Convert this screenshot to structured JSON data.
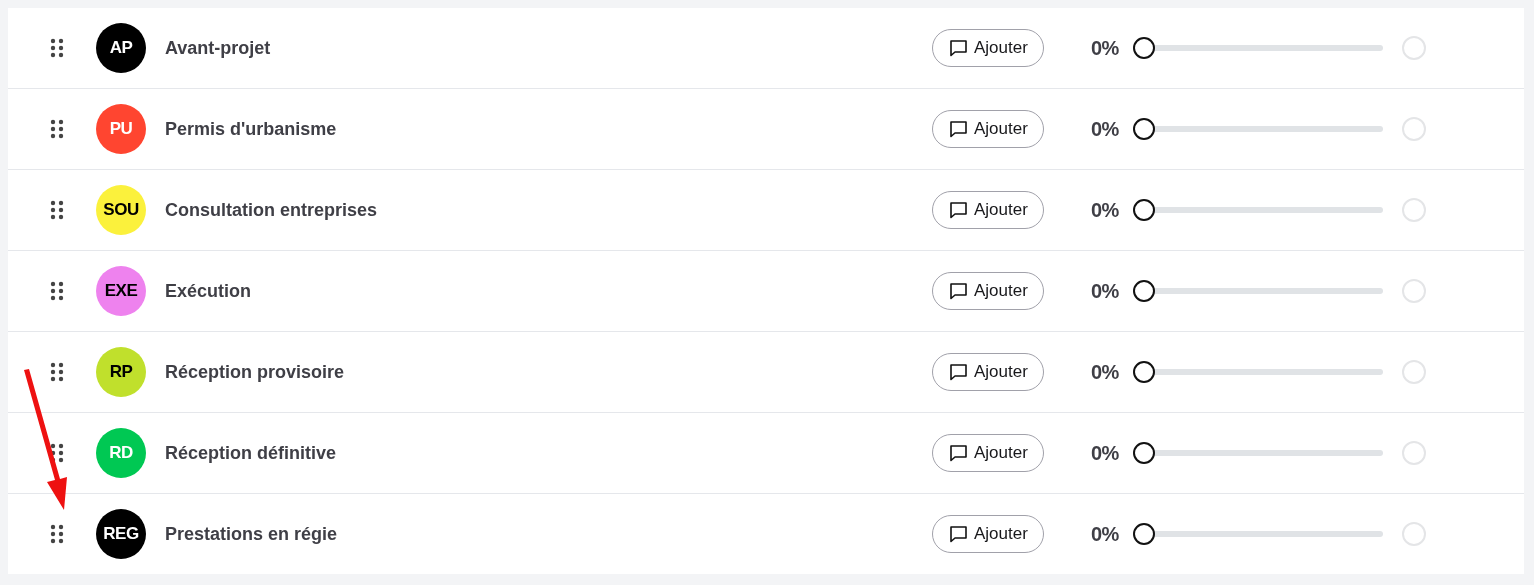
{
  "phases": [
    {
      "abbr": "AP",
      "color": "#000000",
      "name": "Avant-projet",
      "button": "Ajouter",
      "reading": "0%",
      "level": 0,
      "completed": false
    },
    {
      "abbr": "PU",
      "color": "#ff4530",
      "name": "Permis d'urbanisme",
      "button": "Ajouter",
      "reading": "0%",
      "level": 0,
      "completed": false
    },
    {
      "abbr": "SOU",
      "color": "#fbf13c",
      "name": "Consultation entreprises",
      "button": "Ajouter",
      "reading": "0%",
      "level": 0,
      "completed": false
    },
    {
      "abbr": "EXE",
      "color": "#ee82ee",
      "name": "Exécution",
      "button": "Ajouter",
      "reading": "0%",
      "level": 0,
      "completed": false
    },
    {
      "abbr": "RP",
      "color": "#c0e02c",
      "name": "Réception provisoire",
      "button": "Ajouter",
      "reading": "0%",
      "level": 0,
      "completed": false
    },
    {
      "abbr": "RD",
      "color": "#00c853",
      "name": "Réception définitive",
      "button": "Ajouter",
      "reading": "0%",
      "level": 0,
      "completed": false
    },
    {
      "abbr": "REG",
      "color": "#000000",
      "name": "Prestations en régie",
      "button": "Ajouter",
      "reading": "0%",
      "level": 0,
      "completed": false
    }
  ]
}
